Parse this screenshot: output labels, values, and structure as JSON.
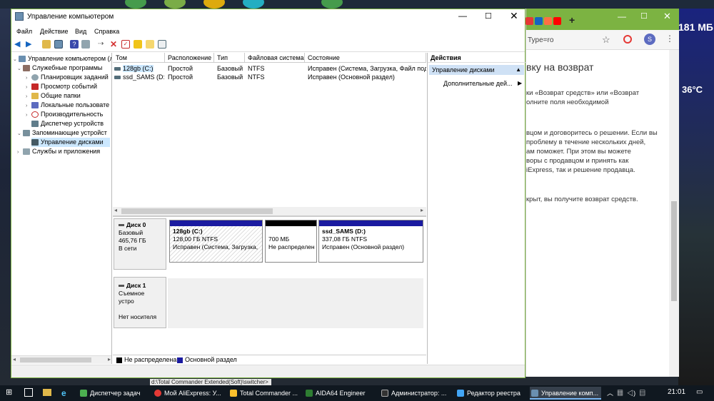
{
  "desktop": {
    "temp_left": "181 МБ",
    "temp_right": "36°C",
    "under_text": "d:\\Total Commander Extended(Soft)\\switcher>"
  },
  "browser": {
    "url_text": "Type=ro",
    "avatar_letter": "S",
    "content_lines": [
      "вку на возврат",
      "",
      "ки «Возврат средств» или «Возврат",
      "олните поля необходимой",
      "",
      "",
      "вцом и договоритесь о решении. Если вы",
      "проблему в течение нескольких дней,",
      "ам поможет. При этом вы можете",
      "воры с продавцом и принять как",
      "iExpress, так и решение продавца.",
      "",
      "",
      "крыт, вы получите возврат средств."
    ]
  },
  "window": {
    "title": "Управление компьютером",
    "menu": [
      "Файл",
      "Действие",
      "Вид",
      "Справка"
    ]
  },
  "tree": {
    "root": "Управление компьютером (л",
    "items": [
      {
        "label": "Служебные программы",
        "indent": 1
      },
      {
        "label": "Планировщик заданий",
        "indent": 2
      },
      {
        "label": "Просмотр событий",
        "indent": 2
      },
      {
        "label": "Общие папки",
        "indent": 2
      },
      {
        "label": "Локальные пользовате",
        "indent": 2
      },
      {
        "label": "Производительность",
        "indent": 2
      },
      {
        "label": "Диспетчер устройств",
        "indent": 2
      },
      {
        "label": "Запоминающие устройст",
        "indent": 1
      },
      {
        "label": "Управление дисками",
        "indent": 2
      },
      {
        "label": "Службы и приложения",
        "indent": 1
      }
    ]
  },
  "volumes": {
    "columns": [
      "Том",
      "Расположение",
      "Тип",
      "Файловая система",
      "Состояние"
    ],
    "rows": [
      [
        "128gb (C:)",
        "Простой",
        "Базовый",
        "NTFS",
        "Исправен (Система, Загрузка, Файл подк"
      ],
      [
        "ssd_SAMS (D:)",
        "Простой",
        "Базовый",
        "NTFS",
        "Исправен (Основной раздел)"
      ]
    ]
  },
  "disks": {
    "disk0": {
      "name": "Диск 0",
      "type": "Базовый",
      "size": "465,76 ГБ",
      "status": "В сети",
      "parts": [
        {
          "name": "128gb  (C:)",
          "size": "128,00 ГБ NTFS",
          "status": "Исправен (Система, Загрузка,"
        },
        {
          "name": "",
          "size": "700 МБ",
          "status": "Не распределен"
        },
        {
          "name": "ssd_SAMS  (D:)",
          "size": "337,08 ГБ NTFS",
          "status": "Исправен (Основной раздел)"
        }
      ]
    },
    "disk1": {
      "name": "Диск 1",
      "type": "Съемное устро",
      "status": "Нет носителя"
    }
  },
  "legend": {
    "unallocated": "Не распределена",
    "primary": "Основной раздел"
  },
  "actions": {
    "header": "Действия",
    "selected": "Управление дисками",
    "more": "Дополнительные дей..."
  },
  "taskbar": {
    "items": [
      "Диспетчер задач",
      "Мой AliExpress: У...",
      "Total Commander ...",
      "AIDA64 Engineer",
      "Администратор: ...",
      "Редактор реестра",
      "Управление комп..."
    ],
    "clock": "21:01"
  },
  "colors": {
    "accent_green": "#7cb342",
    "primary_partition": "#1a1aa0",
    "unallocated": "#000000",
    "selection": "#cce8ff"
  }
}
